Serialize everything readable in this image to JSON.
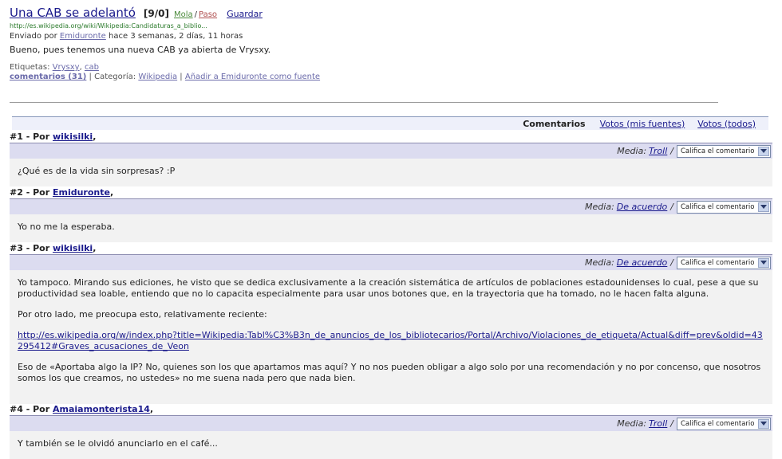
{
  "story": {
    "title": "Una CAB se adelantó",
    "counter": "[9/0]",
    "vote_up": "Mola",
    "vote_sep": "/",
    "vote_down": "Paso",
    "save": "Guardar",
    "url": "http://es.wikipedia.org/wiki/Wikipedia:Candidaturas_a_biblio...",
    "sent_prefix": "Enviado por",
    "author": "Emiduronte",
    "sent_suffix": "hace 3 semanas, 2 días, 11 horas",
    "body": "Bueno, pues tenemos una nueva CAB ya abierta de Vrysxy.",
    "tags_label": "Etiquetas:",
    "tags": [
      "Vrysxy",
      "cab"
    ],
    "comments_link": "comentarios (31)",
    "category_label": "Categoría:",
    "category": "Wikipedia",
    "add_source": "Añadir a Emiduronte como fuente"
  },
  "tabs": {
    "active": "Comentarios",
    "votes_sources": "Votos (mis fuentes)",
    "votes_all": "Votos (todos)"
  },
  "rate_placeholder": "Califica el comentario",
  "media_label": "Media:",
  "comments": [
    {
      "num": "#1 - Por",
      "user": "wikisilki",
      "media": "Troll",
      "paragraphs": [
        "¿Qué es de la vida sin sorpresas? :P"
      ]
    },
    {
      "num": "#2 - Por",
      "user": "Emiduronte",
      "media": "De acuerdo",
      "paragraphs": [
        "Yo no me la esperaba."
      ]
    },
    {
      "num": "#3 - Por",
      "user": "wikisilki",
      "media": "De acuerdo",
      "p1": "Yo tampoco. Mirando sus ediciones, he visto que se dedica exclusivamente a la creación sistemática de artículos de poblaciones estadounidenses lo cual, pese a que su productividad sea loable, entiendo que no lo capacita especialmente para usar unos botones que, en la trayectoria que ha tomado, no le hacen falta alguna.",
      "p2": "Por otro lado, me preocupa esto, relativamente reciente:",
      "link": "http://es.wikipedia.org/w/index.php?title=Wikipedia:Tabl%C3%B3n_de_anuncios_de_los_bibliotecarios/Portal/Archivo/Violaciones_de_etiqueta/Actual&diff=prev&oldid=43295412#Graves_acusaciones_de_Veon",
      "p3": "Eso de «Aportaba algo la IP? No, quienes son los que apartamos mas aquí? Y no nos pueden obligar a algo solo por una recomendación y no por concenso, que nosotros somos los que creamos, no ustedes» no me suena nada pero que nada bien."
    },
    {
      "num": "#4 - Por",
      "user": "Amaiamonterista14",
      "media": "Troll",
      "paragraphs": [
        "Y también se le olvidó anunciarlo en el café..."
      ]
    }
  ]
}
